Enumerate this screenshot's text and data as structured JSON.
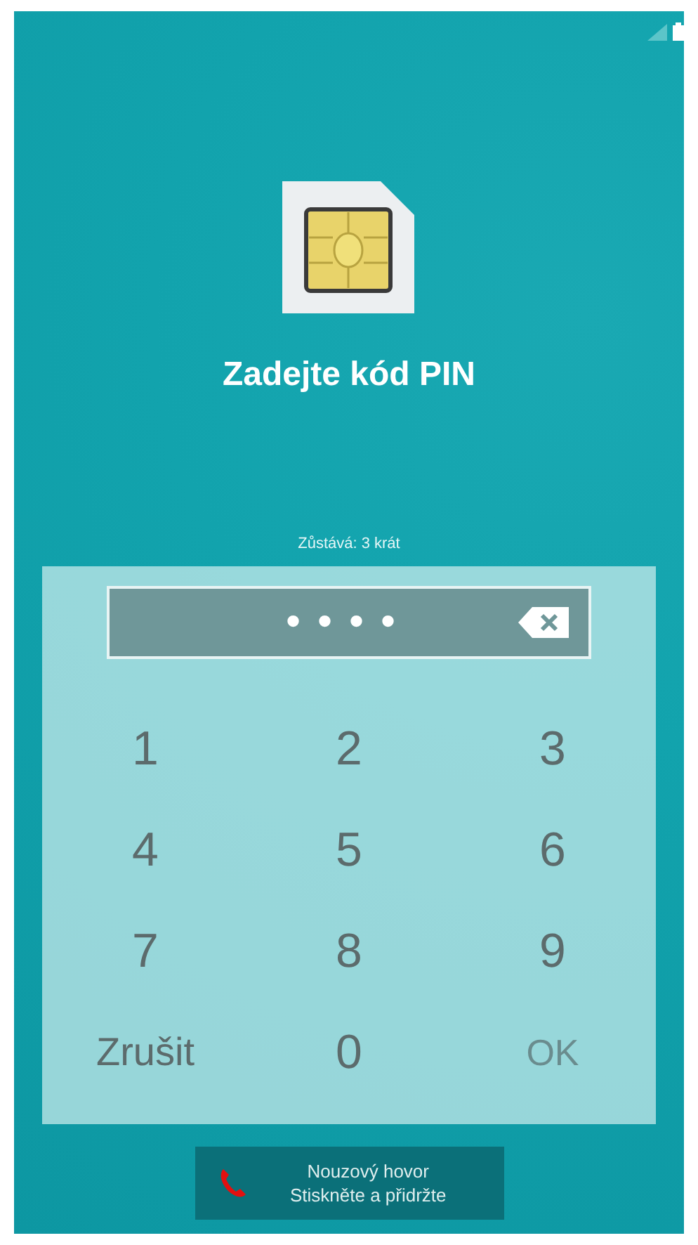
{
  "title": "Zadejte kód PIN",
  "attempts": "Zůstává: 3 krát",
  "pin_field": {
    "value": "••••"
  },
  "keys": [
    {
      "label": "1",
      "kind": "digit",
      "disabled": false
    },
    {
      "label": "2",
      "kind": "digit",
      "disabled": false
    },
    {
      "label": "3",
      "kind": "digit",
      "disabled": false
    },
    {
      "label": "4",
      "kind": "digit",
      "disabled": false
    },
    {
      "label": "5",
      "kind": "digit",
      "disabled": false
    },
    {
      "label": "6",
      "kind": "digit",
      "disabled": false
    },
    {
      "label": "7",
      "kind": "digit",
      "disabled": false
    },
    {
      "label": "8",
      "kind": "digit",
      "disabled": false
    },
    {
      "label": "9",
      "kind": "digit",
      "disabled": false
    },
    {
      "label": "Zrušit",
      "kind": "cancel",
      "disabled": false
    },
    {
      "label": "0",
      "kind": "digit",
      "disabled": false
    },
    {
      "label": "OK",
      "kind": "ok",
      "disabled": true
    }
  ],
  "emergency": {
    "line_1": "Nouzový hovor",
    "line_2": "Stiskněte a přidržte"
  }
}
